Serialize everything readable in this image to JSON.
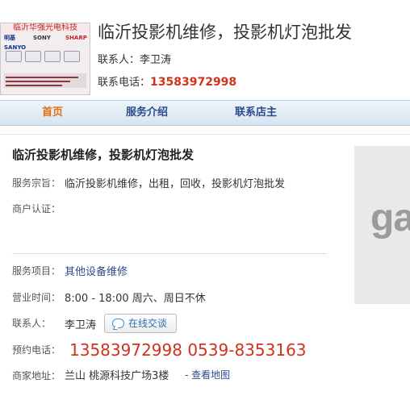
{
  "header": {
    "logo": {
      "company_text": "临沂华强光电科技",
      "brands": [
        "明基",
        "SONY",
        "SHARP",
        "SANYO"
      ],
      "brand_colors": {
        "primary": "#15308a",
        "accent": "#c0282c"
      }
    },
    "title": "临沂投影机维修，投影机灯泡批发",
    "contact_label": "联系人：",
    "contact_name": "李卫涛",
    "phone_label": "联系电话：",
    "phone": "13583972998"
  },
  "nav": {
    "items": [
      {
        "label": "首页",
        "active": true
      },
      {
        "label": "服务介绍",
        "active": false
      },
      {
        "label": "联系店主",
        "active": false
      }
    ],
    "active_color": "#e07010",
    "color": "#2b4c8a"
  },
  "main": {
    "title": "临沂投影机维修，投影机灯泡批发",
    "purpose_label": "服务宗旨：",
    "purpose_value": "临沂投影机维修，出租，回收，投影机灯泡批发",
    "cert_label": "商户认证：",
    "service_label": "服务项目：",
    "service_value": "其他设备维修",
    "hours_label": "营业时间：",
    "hours_value": "8:00 - 18:00 周六、周日不休",
    "contact_label": "联系人：",
    "contact_value": "李卫涛",
    "chat_button": "在线交谈",
    "booking_label": "预约电话：",
    "booking_phones": "13583972998 0539-8353163",
    "address_label": "商家地址：",
    "address_value": "兰山 桃源科技广场3楼",
    "map_link": "- 查看地图",
    "phone_color": "#d0321c"
  },
  "ad": {
    "text": "ga"
  }
}
